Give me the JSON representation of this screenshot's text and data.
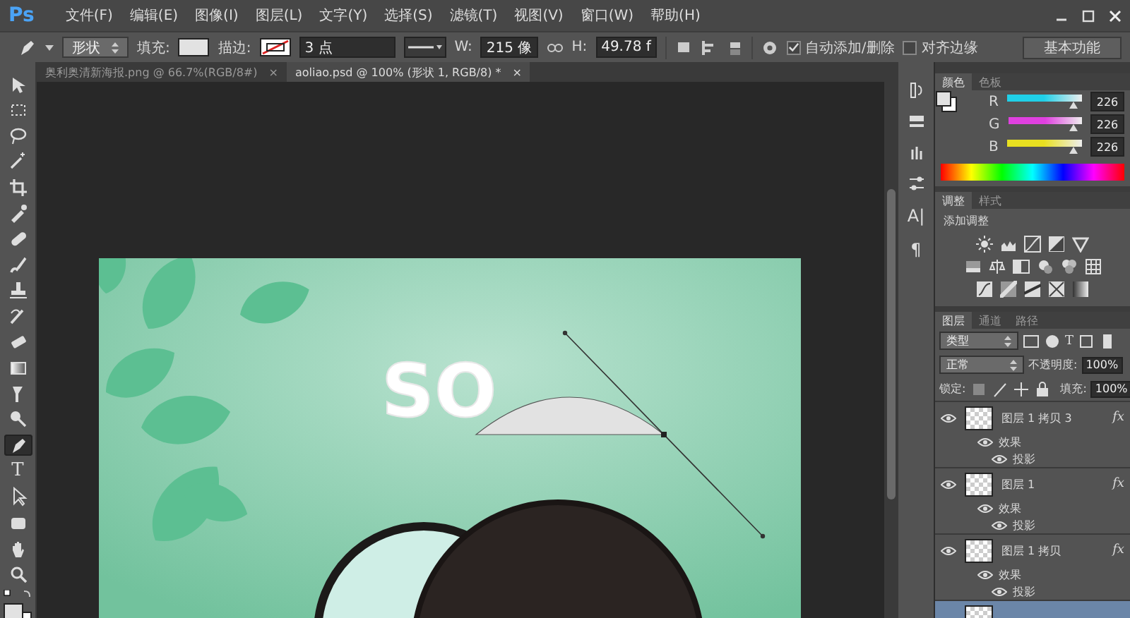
{
  "menu_bar": {
    "logo": "Ps",
    "items": [
      "文件(F)",
      "编辑(E)",
      "图像(I)",
      "图层(L)",
      "文字(Y)",
      "选择(S)",
      "滤镜(T)",
      "视图(V)",
      "窗口(W)",
      "帮助(H)"
    ]
  },
  "options_bar": {
    "tool_mode": "形状",
    "fill_label": "填充:",
    "stroke_label": "描边:",
    "stroke_width": "3 点",
    "w_label": "W:",
    "w_value": "215 像",
    "h_label": "H:",
    "h_value": "49.78 f",
    "auto_add_delete": {
      "label": "自动添加/删除",
      "checked": true
    },
    "align_edges": {
      "label": "对齐边缘",
      "checked": false
    },
    "workspace": "基本功能"
  },
  "document_tabs": [
    {
      "label": "奥利奥清新海报.png @ 66.7%(RGB/8#)",
      "close": "×",
      "selected": false
    },
    {
      "label": "aoliao.psd @ 100% (形状 1, RGB/8) *",
      "close": "×",
      "selected": true
    }
  ],
  "tools": [
    {
      "selected": false
    },
    {
      "selected": false
    },
    {
      "selected": false
    },
    {
      "selected": false
    },
    {
      "selected": false
    },
    {
      "selected": false
    },
    {
      "selected": false
    },
    {
      "selected": false
    },
    {
      "selected": false
    },
    {
      "selected": false
    },
    {
      "selected": false
    },
    {
      "selected": false
    },
    {
      "selected": false
    },
    {
      "selected": false
    },
    {
      "selected": true
    },
    {
      "selected": false,
      "glyph": "T"
    },
    {
      "selected": false
    },
    {
      "selected": false
    },
    {
      "selected": false
    },
    {
      "selected": false
    }
  ],
  "canvas": {
    "headline": "SO"
  },
  "panel_dock": {
    "glyphs": [
      "A|",
      "¶"
    ]
  },
  "color_panel": {
    "tabs": [
      {
        "label": "颜色",
        "selected": true
      },
      {
        "label": "色板",
        "selected": false
      }
    ],
    "channels": [
      {
        "name": "R",
        "level": 0.89,
        "value": "226",
        "color": "#20d0e8"
      },
      {
        "name": "G",
        "level": 0.89,
        "value": "226",
        "color": "#e040e0"
      },
      {
        "name": "B",
        "level": 0.89,
        "value": "226",
        "color": "#e8e020"
      }
    ]
  },
  "adjustments_panel": {
    "tabs": [
      {
        "label": "调整",
        "selected": true
      },
      {
        "label": "样式",
        "selected": false
      }
    ],
    "title": "添加调整"
  },
  "layers_panel": {
    "tabs": [
      {
        "label": "图层",
        "selected": true
      },
      {
        "label": "通道",
        "selected": false
      },
      {
        "label": "路径",
        "selected": false
      }
    ],
    "filter": "类型",
    "filter_glyph": "T",
    "blend_mode": "正常",
    "opacity_label": "不透明度:",
    "opacity": "100%",
    "lock_label": "锁定:",
    "fill_label": "填充:",
    "fill": "100%",
    "layers": [
      {
        "name": "图层 1 拷贝 3",
        "visible": true,
        "selected": false,
        "fx": "fx",
        "effects_label": "效果",
        "effects": [
          "投影"
        ]
      },
      {
        "name": "图层 1",
        "visible": true,
        "selected": false,
        "fx": "fx",
        "effects_label": "效果",
        "effects": [
          "投影"
        ]
      },
      {
        "name": "图层 1 拷贝",
        "visible": true,
        "selected": false,
        "fx": "fx",
        "effects_label": "效果",
        "effects": [
          "投影"
        ]
      },
      {
        "selected": true
      }
    ]
  }
}
